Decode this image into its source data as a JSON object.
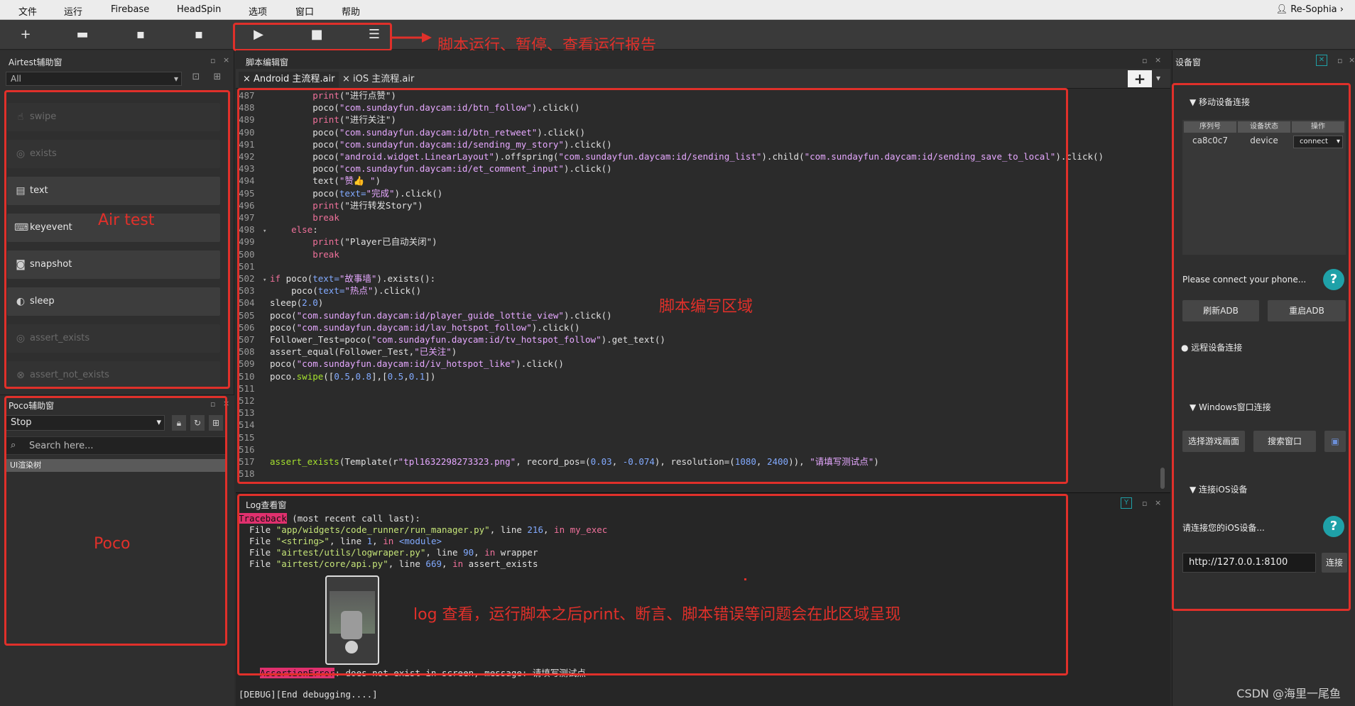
{
  "menubar": {
    "items": [
      "文件",
      "运行",
      "Firebase",
      "HeadSpin",
      "选项",
      "窗口",
      "帮助"
    ],
    "user": "Re-Sophia"
  },
  "annotations": {
    "toolbar": "脚本运行、暂停、查看运行报告",
    "airtest": "Air test",
    "editor": "脚本编写区域",
    "poco": "Poco",
    "log": "log 查看，运行脚本之后print、断言、脚本错误等问题会在此区域呈现"
  },
  "airtest_panel": {
    "title": "Airtest辅助窗",
    "filter_value": "All",
    "items": [
      {
        "label": "swipe",
        "icon": "swipe-icon",
        "enabled": false
      },
      {
        "label": "exists",
        "icon": "exists-icon",
        "enabled": false
      },
      {
        "label": "text",
        "icon": "text-icon",
        "enabled": true
      },
      {
        "label": "keyevent",
        "icon": "keyboard-icon",
        "enabled": true
      },
      {
        "label": "snapshot",
        "icon": "camera-icon",
        "enabled": true
      },
      {
        "label": "sleep",
        "icon": "sleep-icon",
        "enabled": true
      },
      {
        "label": "assert_exists",
        "icon": "assert-exists-icon",
        "enabled": false
      },
      {
        "label": "assert_not_exists",
        "icon": "assert-not-exists-icon",
        "enabled": false
      }
    ]
  },
  "poco_panel": {
    "title": "Poco辅助窗",
    "mode": "Stop",
    "search_placeholder": "Search here...",
    "tree_root": "UI渲染树"
  },
  "editor": {
    "title": "脚本编辑窗",
    "tabs": [
      "Android 主流程.air",
      "iOS 主流程.air"
    ],
    "lines": [
      {
        "n": "487",
        "fold": "",
        "segs": [
          [
            "        ",
            "plain"
          ],
          [
            "print",
            "kw"
          ],
          [
            "(\"进行点赞\")",
            "plain"
          ]
        ]
      },
      {
        "n": "488",
        "fold": "",
        "segs": [
          [
            "        poco(",
            "plain"
          ],
          [
            "\"com.sundayfun.daycam:id/btn_follow\"",
            "str"
          ],
          [
            ").click()",
            "plain"
          ]
        ]
      },
      {
        "n": "489",
        "fold": "",
        "segs": [
          [
            "        ",
            "plain"
          ],
          [
            "print",
            "kw"
          ],
          [
            "(\"进行关注\")",
            "plain"
          ]
        ]
      },
      {
        "n": "490",
        "fold": "",
        "segs": [
          [
            "        poco(",
            "plain"
          ],
          [
            "\"com.sundayfun.daycam:id/btn_retweet\"",
            "str"
          ],
          [
            ").click()",
            "plain"
          ]
        ]
      },
      {
        "n": "491",
        "fold": "",
        "segs": [
          [
            "        poco(",
            "plain"
          ],
          [
            "\"com.sundayfun.daycam:id/sending_my_story\"",
            "str"
          ],
          [
            ").click()",
            "plain"
          ]
        ]
      },
      {
        "n": "492",
        "fold": "",
        "segs": [
          [
            "        poco(",
            "plain"
          ],
          [
            "\"android.widget.LinearLayout\"",
            "str"
          ],
          [
            ").offspring(",
            "plain"
          ],
          [
            "\"com.sundayfun.daycam:id/sending_list\"",
            "str"
          ],
          [
            ").child(",
            "plain"
          ],
          [
            "\"com.sundayfun.daycam:id/sending_save_to_local\"",
            "str"
          ],
          [
            ").click()",
            "plain"
          ]
        ]
      },
      {
        "n": "493",
        "fold": "",
        "segs": [
          [
            "        poco(",
            "plain"
          ],
          [
            "\"com.sundayfun.daycam:id/et_comment_input\"",
            "str"
          ],
          [
            ").click()",
            "plain"
          ]
        ]
      },
      {
        "n": "494",
        "fold": "",
        "segs": [
          [
            "        text(",
            "plain"
          ],
          [
            "\"赞👍 \"",
            "str"
          ],
          [
            ")",
            "plain"
          ]
        ]
      },
      {
        "n": "495",
        "fold": "",
        "segs": [
          [
            "        poco(",
            "plain"
          ],
          [
            "text=",
            "num"
          ],
          [
            "\"完成\"",
            "str"
          ],
          [
            ").click()",
            "plain"
          ]
        ]
      },
      {
        "n": "496",
        "fold": "",
        "segs": [
          [
            "        ",
            "plain"
          ],
          [
            "print",
            "kw"
          ],
          [
            "(\"进行转发Story\")",
            "plain"
          ]
        ]
      },
      {
        "n": "497",
        "fold": "",
        "segs": [
          [
            "        ",
            "plain"
          ],
          [
            "break",
            "kw"
          ]
        ]
      },
      {
        "n": "498",
        "fold": "▾",
        "segs": [
          [
            "    ",
            "plain"
          ],
          [
            "else",
            "kw"
          ],
          [
            ":",
            "plain"
          ]
        ]
      },
      {
        "n": "499",
        "fold": "",
        "segs": [
          [
            "        ",
            "plain"
          ],
          [
            "print",
            "kw"
          ],
          [
            "(\"Player已自动关闭\")",
            "plain"
          ]
        ]
      },
      {
        "n": "500",
        "fold": "",
        "segs": [
          [
            "        ",
            "plain"
          ],
          [
            "break",
            "kw"
          ]
        ]
      },
      {
        "n": "501",
        "fold": "",
        "segs": []
      },
      {
        "n": "502",
        "fold": "▾",
        "segs": [
          [
            "if",
            "kw"
          ],
          [
            " poco(",
            "plain"
          ],
          [
            "text=",
            "num"
          ],
          [
            "\"故事墙\"",
            "str"
          ],
          [
            ").exists():",
            "plain"
          ]
        ]
      },
      {
        "n": "503",
        "fold": "",
        "segs": [
          [
            "    poco(",
            "plain"
          ],
          [
            "text=",
            "num"
          ],
          [
            "\"热点\"",
            "str"
          ],
          [
            ").click()",
            "plain"
          ]
        ]
      },
      {
        "n": "504",
        "fold": "",
        "segs": [
          [
            "sleep(",
            "plain"
          ],
          [
            "2.0",
            "num"
          ],
          [
            ")",
            "plain"
          ]
        ]
      },
      {
        "n": "505",
        "fold": "",
        "segs": [
          [
            "poco(",
            "plain"
          ],
          [
            "\"com.sundayfun.daycam:id/player_guide_lottie_view\"",
            "str"
          ],
          [
            ").click()",
            "plain"
          ]
        ]
      },
      {
        "n": "506",
        "fold": "",
        "segs": [
          [
            "poco(",
            "plain"
          ],
          [
            "\"com.sundayfun.daycam:id/lav_hotspot_follow\"",
            "str"
          ],
          [
            ").click()",
            "plain"
          ]
        ]
      },
      {
        "n": "507",
        "fold": "",
        "segs": [
          [
            "Follower_Test=poco(",
            "plain"
          ],
          [
            "\"com.sundayfun.daycam:id/tv_hotspot_follow\"",
            "str"
          ],
          [
            ").get_text()",
            "plain"
          ]
        ]
      },
      {
        "n": "508",
        "fold": "",
        "segs": [
          [
            "assert_equal(Follower_Test,",
            "plain"
          ],
          [
            "\"已关注\"",
            "str"
          ],
          [
            ")",
            "plain"
          ]
        ]
      },
      {
        "n": "509",
        "fold": "",
        "segs": [
          [
            "poco(",
            "plain"
          ],
          [
            "\"com.sundayfun.daycam:id/iv_hotspot_like\"",
            "str"
          ],
          [
            ").click()",
            "plain"
          ]
        ]
      },
      {
        "n": "510",
        "fold": "",
        "segs": [
          [
            "poco.",
            "plain"
          ],
          [
            "swipe",
            "fn"
          ],
          [
            "([",
            "plain"
          ],
          [
            "0.5",
            "num"
          ],
          [
            ",",
            "plain"
          ],
          [
            "0.8",
            "num"
          ],
          [
            "],[",
            "plain"
          ],
          [
            "0.5",
            "num"
          ],
          [
            ",",
            "plain"
          ],
          [
            "0.1",
            "num"
          ],
          [
            "])",
            "plain"
          ]
        ]
      },
      {
        "n": "511",
        "fold": "",
        "segs": []
      },
      {
        "n": "512",
        "fold": "",
        "segs": []
      },
      {
        "n": "513",
        "fold": "",
        "segs": []
      },
      {
        "n": "514",
        "fold": "",
        "segs": []
      },
      {
        "n": "515",
        "fold": "",
        "segs": []
      },
      {
        "n": "516",
        "fold": "",
        "segs": []
      },
      {
        "n": "517",
        "fold": "",
        "segs": [
          [
            "assert_exists",
            "fn"
          ],
          [
            "(Template(r",
            "plain"
          ],
          [
            "\"tpl1632298273323.png\"",
            "str"
          ],
          [
            ", record_pos=(",
            "plain"
          ],
          [
            "0.03",
            "num"
          ],
          [
            ", ",
            "plain"
          ],
          [
            "-0.074",
            "num"
          ],
          [
            "), resolution=(",
            "plain"
          ],
          [
            "1080",
            "num"
          ],
          [
            ", ",
            "plain"
          ],
          [
            "2400",
            "num"
          ],
          [
            ")), ",
            "plain"
          ],
          [
            "\"请填写测试点\"",
            "str"
          ],
          [
            ")",
            "plain"
          ]
        ]
      },
      {
        "n": "518",
        "fold": "",
        "segs": []
      }
    ]
  },
  "log": {
    "title": "Log查看窗",
    "lines": [
      [
        [
          "Traceback",
          "tb"
        ],
        [
          " (most recent call last):",
          "plain"
        ]
      ],
      [
        [
          "  File ",
          "plain"
        ],
        [
          "\"app/widgets/code_runner/run_manager.py\"",
          "str"
        ],
        [
          ", line ",
          "plain"
        ],
        [
          "216",
          "num"
        ],
        [
          ", ",
          "plain"
        ],
        [
          "in",
          "kw"
        ],
        [
          " my_exec",
          "kw"
        ]
      ],
      [
        [
          "  File ",
          "plain"
        ],
        [
          "\"<string>\"",
          "str"
        ],
        [
          ", line ",
          "plain"
        ],
        [
          "1",
          "num"
        ],
        [
          ", ",
          "plain"
        ],
        [
          "in",
          "kw"
        ],
        [
          " <module>",
          "num"
        ]
      ],
      [
        [
          "  File ",
          "plain"
        ],
        [
          "\"airtest/utils/logwraper.py\"",
          "str"
        ],
        [
          ", line ",
          "plain"
        ],
        [
          "90",
          "num"
        ],
        [
          ", ",
          "plain"
        ],
        [
          "in",
          "kw"
        ],
        [
          " wrapper",
          "plain"
        ]
      ],
      [
        [
          "  File ",
          "plain"
        ],
        [
          "\"airtest/core/api.py\"",
          "str"
        ],
        [
          ", line ",
          "plain"
        ],
        [
          "669",
          "num"
        ],
        [
          ", ",
          "plain"
        ],
        [
          "in",
          "kw"
        ],
        [
          " assert_exists",
          "plain"
        ]
      ]
    ],
    "error_label": "AssertionError",
    "error_message": ": does not exist in screen, message: 请填写测试点",
    "debug_line": "[DEBUG][End debugging....]"
  },
  "device_panel": {
    "title": "设备窗",
    "mobile_section": "移动设备连接",
    "columns": [
      "序列号",
      "设备状态",
      "操作"
    ],
    "device": {
      "serial": "ca8c0c7",
      "status": "device",
      "action": "connect"
    },
    "connect_hint": "Please connect your phone...",
    "refresh_adb": "刷新ADB",
    "restart_adb": "重启ADB",
    "remote_section": "远程设备连接",
    "windows_section": "Windows窗口连接",
    "select_game": "选择游戏画面",
    "search_window": "搜索窗口",
    "ios_section": "连接iOS设备",
    "ios_hint": "请连接您的iOS设备...",
    "ios_url": "http://127.0.0.1:8100",
    "ios_connect": "连接"
  },
  "watermark": "CSDN @海里一尾鱼",
  "colors": {
    "annotation": "#e0302a",
    "accent": "#1fa1a8"
  }
}
